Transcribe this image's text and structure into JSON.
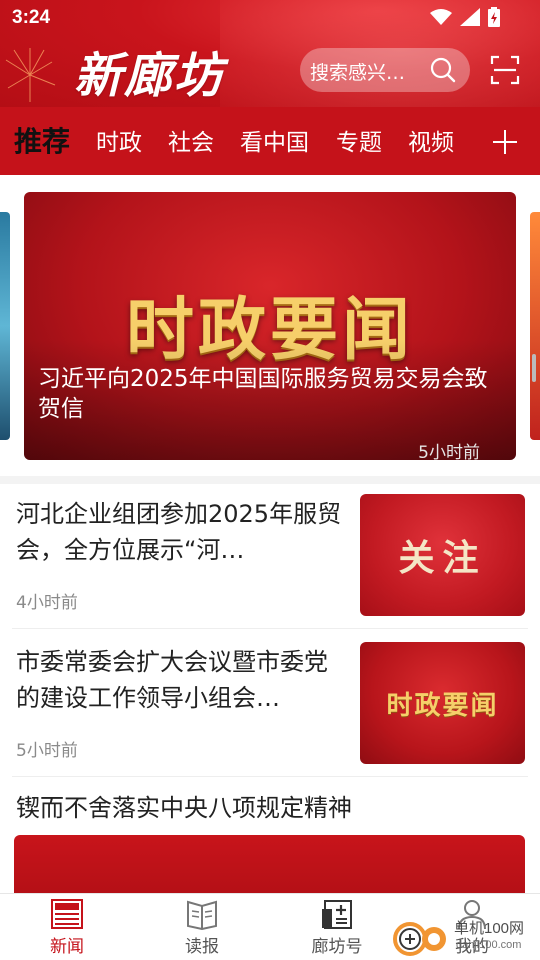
{
  "status_bar": {
    "time": "3:24"
  },
  "header": {
    "logo_text": "新廊坊",
    "search_placeholder": "搜索感兴…",
    "icons": [
      "search-icon",
      "scan-icon"
    ]
  },
  "tabs": {
    "items": [
      {
        "label": "推荐",
        "active": true
      },
      {
        "label": "时政"
      },
      {
        "label": "社会"
      },
      {
        "label": "看中国"
      },
      {
        "label": "专题"
      },
      {
        "label": "视频"
      }
    ],
    "more_icon": "plus-icon"
  },
  "carousel": {
    "banner_image_text": "时政要闻",
    "headline": "习近平向2025年中国国际服务贸易交易会致贺信",
    "time": "5小时前"
  },
  "news": [
    {
      "title": "河北企业组团参加2025年服贸会，全方位展示“河…",
      "time": "4小时前",
      "thumb_text": "关注"
    },
    {
      "title": "市委常委会扩大会议暨市委党的建设工作领导小组会…",
      "time": "5小时前",
      "thumb_text": "时政要闻"
    },
    {
      "title": "锲而不舍落实中央八项规定精神"
    }
  ],
  "bottom_nav": [
    {
      "label": "新闻",
      "icon": "news-icon",
      "active": true
    },
    {
      "label": "读报",
      "icon": "newspaper-icon"
    },
    {
      "label": "廊坊号",
      "icon": "account-icon"
    },
    {
      "label": "我的",
      "icon": "user-icon"
    }
  ],
  "watermark": {
    "text": "单机100网",
    "url": "danji100.com"
  },
  "colors": {
    "brand_red": "#c5121a",
    "gold": "#f6cf6a",
    "active_tab": "#111111"
  }
}
